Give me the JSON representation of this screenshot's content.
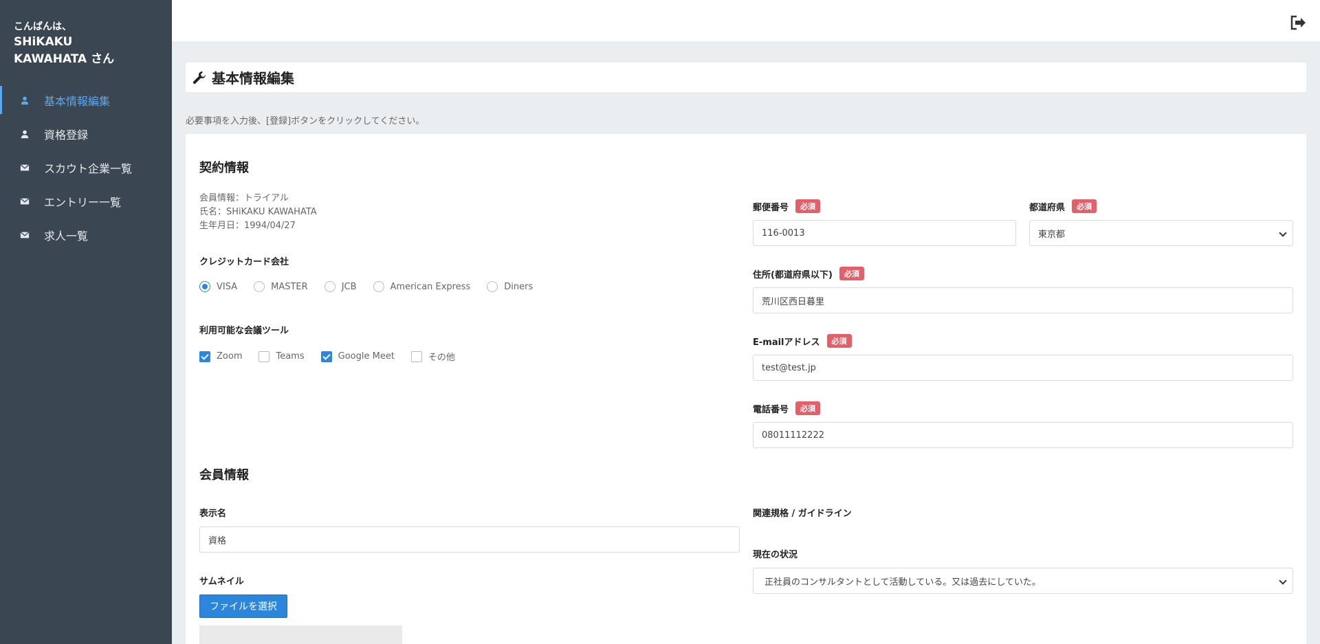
{
  "sidebar": {
    "greeting_line1": "こんばんは、",
    "greeting_line2": "SHiKAKU",
    "greeting_line3": "KAWAHATA さん",
    "items": [
      {
        "label": "基本情報編集",
        "icon": "user-icon"
      },
      {
        "label": "資格登録",
        "icon": "user-icon"
      },
      {
        "label": "スカウト企業一覧",
        "icon": "envelope-icon"
      },
      {
        "label": "エントリー一覧",
        "icon": "envelope-icon"
      },
      {
        "label": "求人一覧",
        "icon": "envelope-icon"
      }
    ]
  },
  "header": {
    "logout_icon": "sign-out-icon"
  },
  "page": {
    "title": "基本情報編集",
    "title_icon": "wrench-icon",
    "notice": "必要事項を入力後、[登録]ボタンをクリックしてください。"
  },
  "contract": {
    "section_title": "契約情報",
    "member_info": "会員情報：トライアル",
    "name": "氏名：SHiKAKU KAWAHATA",
    "birthday": "生年月日：1994/04/27",
    "credit_label": "クレジットカード会社",
    "credit_options": [
      "VISA",
      "MASTER",
      "JCB",
      "American Express",
      "Diners"
    ],
    "credit_selected": "VISA",
    "tools_label": "利用可能な会議ツール",
    "tools_options": [
      "Zoom",
      "Teams",
      "Google Meet",
      "その他"
    ],
    "tools_checked": [
      "Zoom",
      "Google Meet"
    ],
    "required_badge": "必須",
    "postal_label": "郵便番号",
    "postal_value": "116-0013",
    "pref_label": "都道府県",
    "pref_value": "東京都",
    "address_label": "住所(都道府県以下)",
    "address_value": "荒川区西日暮里",
    "email_label": "E-mailアドレス",
    "email_value": "test@test.jp",
    "phone_label": "電話番号",
    "phone_value": "08011112222"
  },
  "member": {
    "section_title": "会員情報",
    "display_name_label": "表示名",
    "display_name_value": "資格",
    "thumbnail_label": "サムネイル",
    "file_button": "ファイルを選択",
    "related_label": "関連規格 / ガイドライン",
    "status_label": "現在の状況",
    "status_value": "正社員のコンサルタントとして活動している。又は過去にしていた。"
  },
  "colors": {
    "sidebar_bg": "#3a4651",
    "accent": "#2c86dc",
    "required": "#e3606a",
    "active_nav": "#5aa8f0"
  }
}
